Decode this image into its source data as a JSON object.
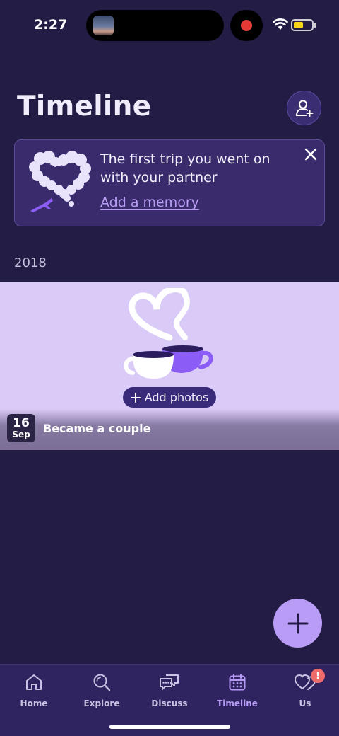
{
  "status_bar": {
    "time": "2:27",
    "battery_color": "#f7d417",
    "recording_color": "#e53935"
  },
  "header": {
    "title": "Timeline",
    "add_partner_icon": "add-person-icon"
  },
  "memory_prompt": {
    "text": "The first trip you went on with your partner",
    "link": "Add a memory",
    "illustration": "heart-cloud-airplane",
    "close_icon": "close-icon"
  },
  "timeline": {
    "year": "2018",
    "entries": [
      {
        "day": "16",
        "month": "Sep",
        "title": "Became a couple",
        "add_photos_label": "Add photos",
        "illustration": "coffee-cups-heart-steam"
      }
    ]
  },
  "fab": {
    "icon": "plus-icon"
  },
  "tab_bar": {
    "active_color": "#b59bf5",
    "items": [
      {
        "label": "Home",
        "icon": "home-icon",
        "active": false
      },
      {
        "label": "Explore",
        "icon": "search-icon",
        "active": false
      },
      {
        "label": "Discuss",
        "icon": "chat-bubbles-icon",
        "active": false
      },
      {
        "label": "Timeline",
        "icon": "calendar-icon",
        "active": true
      },
      {
        "label": "Us",
        "icon": "hearts-icon",
        "active": false,
        "badge": "!"
      }
    ]
  },
  "colors": {
    "background": "#231c44",
    "accent": "#b99cf5",
    "card": "#3a2c6c",
    "entry_bg": "#dacaf7"
  }
}
